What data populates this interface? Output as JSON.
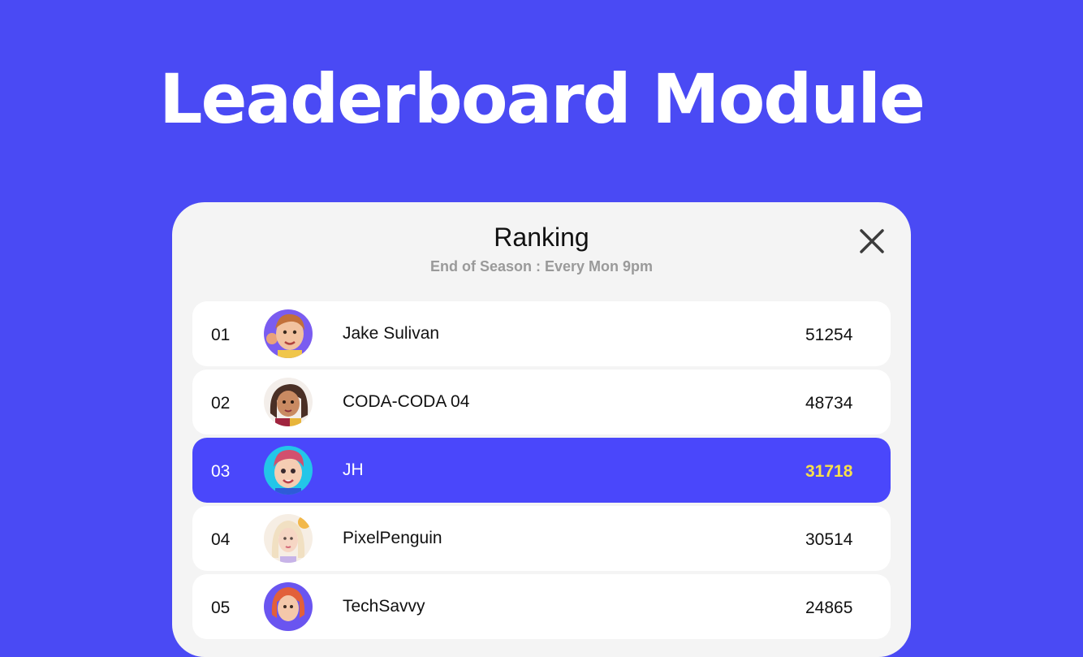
{
  "hero": {
    "title": "Leaderboard Module"
  },
  "panel": {
    "title": "Ranking",
    "subtitle": "End of Season : Every Mon 9pm",
    "close_icon": "close-icon"
  },
  "colors": {
    "background": "#4A4AF4",
    "panel": "#F4F4F4",
    "highlight_row": "#4A47FB",
    "highlight_score": "#F8E04A"
  },
  "rankings": [
    {
      "rank": "01",
      "name": "Jake Sulivan",
      "score": "51254",
      "avatar": "avatar-icon",
      "highlighted": false
    },
    {
      "rank": "02",
      "name": "CODA-CODA 04",
      "score": "48734",
      "avatar": "avatar-icon",
      "highlighted": false
    },
    {
      "rank": "03",
      "name": "JH",
      "score": "31718",
      "avatar": "avatar-icon",
      "highlighted": true
    },
    {
      "rank": "04",
      "name": "PixelPenguin",
      "score": "30514",
      "avatar": "avatar-icon",
      "highlighted": false
    },
    {
      "rank": "05",
      "name": "TechSavvy",
      "score": "24865",
      "avatar": "avatar-icon",
      "highlighted": false
    }
  ]
}
